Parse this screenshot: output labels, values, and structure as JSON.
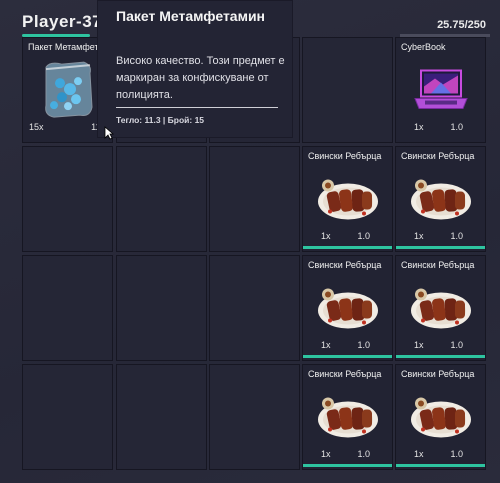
{
  "player": {
    "name": "Player-37"
  },
  "inventory": {
    "weight": "25.75/250"
  },
  "slots": {
    "meth": {
      "label": "Пакет Метамфет",
      "qty": "15x",
      "weight": "11.3"
    },
    "cyberbook": {
      "label": "CyberBook",
      "qty": "1x",
      "weight": "1.0"
    },
    "ribs": {
      "label": "Свински Ребърца",
      "qty": "1x",
      "weight": "1.0"
    }
  },
  "tooltip": {
    "title": "Пакет Метамфетамин",
    "description": "Високо качество. Този предмет е маркиран за конфискуване от полицията.",
    "meta": "Тегло: 11.3 | Брой: 15"
  },
  "colors": {
    "accent": "#2ec4a0",
    "background": "#272838"
  }
}
